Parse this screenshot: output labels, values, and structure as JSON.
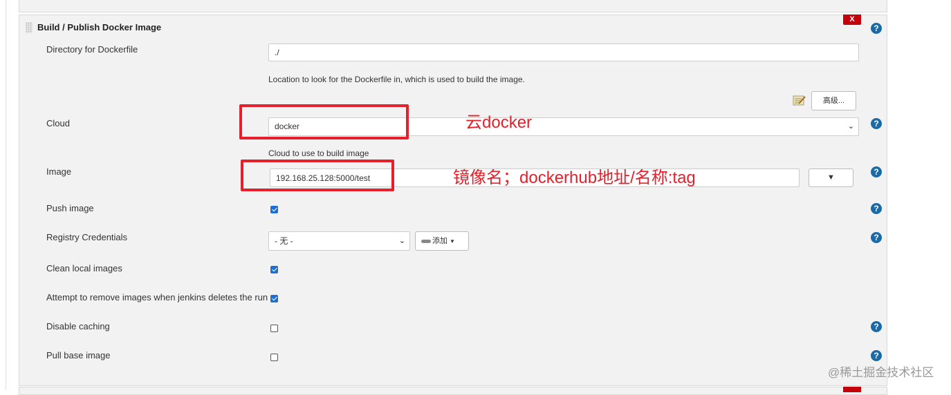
{
  "step": {
    "title": "Build / Publish Docker Image",
    "delete_label": "X",
    "help_label": "?"
  },
  "fields": {
    "dockerfile_dir": {
      "label": "Directory for Dockerfile",
      "value": "./",
      "description": "Location to look for the Dockerfile in, which is used to build the image."
    },
    "advanced_button": "高级...",
    "cloud": {
      "label": "Cloud",
      "selected": "docker",
      "description": "Cloud to use to build image"
    },
    "image": {
      "label": "Image",
      "value": "192.168.25.128:5000/test",
      "dropdown_symbol": "▼"
    },
    "push_image": {
      "label": "Push image",
      "checked": true
    },
    "registry_credentials": {
      "label": "Registry Credentials",
      "selected": "- 无 -",
      "add_button": "添加"
    },
    "clean_local_images": {
      "label": "Clean local images",
      "checked": true
    },
    "attempt_remove": {
      "label": "Attempt to remove images when jenkins deletes the run",
      "checked": true
    },
    "disable_caching": {
      "label": "Disable caching",
      "checked": false
    },
    "pull_base_image": {
      "label": "Pull base image",
      "checked": false
    }
  },
  "annotations": {
    "cloud_note": "云docker",
    "image_note": "镜像名；dockerhub地址/名称:tag"
  },
  "watermark": "@稀土掘金技术社区",
  "colors": {
    "panel_bg": "#f2f2f2",
    "help_icon": "#1a6aa8",
    "delete_red": "#c4000a",
    "annotation_red": "#e5202a",
    "checkbox_blue": "#1f6fd0"
  },
  "icons": {
    "help": "help-icon",
    "notepad": "notepad-icon",
    "key": "key-icon",
    "chevron": "chevron-down-icon",
    "drag": "drag-handle-icon"
  }
}
